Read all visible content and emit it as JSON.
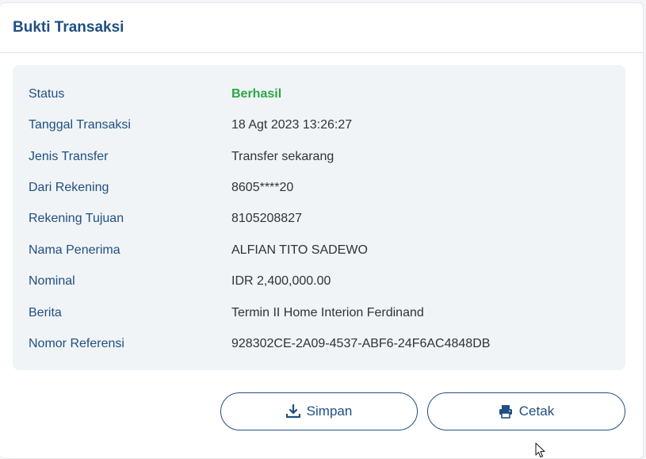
{
  "header": {
    "title": "Bukti Transaksi"
  },
  "details": [
    {
      "label": "Status",
      "value": "Berhasil",
      "status": "success"
    },
    {
      "label": "Tanggal Transaksi",
      "value": "18 Agt 2023 13:26:27"
    },
    {
      "label": "Jenis Transfer",
      "value": "Transfer sekarang"
    },
    {
      "label": "Dari Rekening",
      "value": "8605****20"
    },
    {
      "label": "Rekening Tujuan",
      "value": "8105208827"
    },
    {
      "label": "Nama Penerima",
      "value": "ALFIAN TITO SADEWO"
    },
    {
      "label": "Nominal",
      "value": "IDR 2,400,000.00"
    },
    {
      "label": "Berita",
      "value": "Termin II Home Interion Ferdinand"
    },
    {
      "label": "Nomor Referensi",
      "value": "928302CE-2A09-4537-ABF6-24F6AC4848DB"
    }
  ],
  "actions": {
    "save": {
      "label": "Simpan",
      "icon": "download-icon"
    },
    "print": {
      "label": "Cetak",
      "icon": "printer-icon"
    }
  },
  "colors": {
    "primary": "#1f4f83",
    "success": "#2aa845",
    "panel": "#f1f4f6"
  }
}
